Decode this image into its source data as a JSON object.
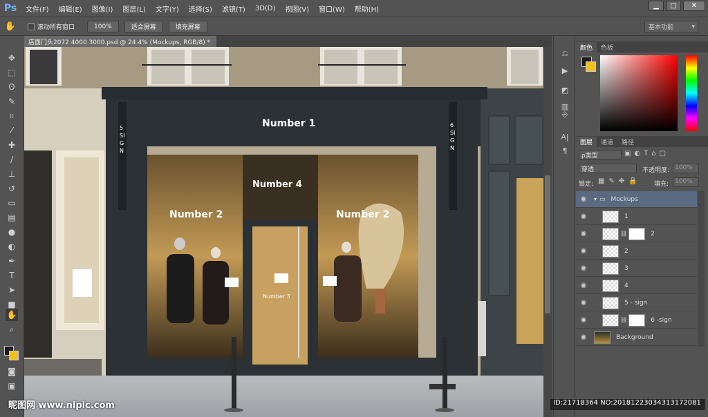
{
  "app_logo": "Ps",
  "menu": [
    "文件(F)",
    "编辑(E)",
    "图像(I)",
    "图层(L)",
    "文字(Y)",
    "选择(S)",
    "滤镜(T)",
    "3D(D)",
    "视图(V)",
    "窗口(W)",
    "帮助(H)"
  ],
  "window_controls": {
    "minimize": "▁",
    "restore": "□",
    "close": "✕"
  },
  "options": {
    "scroll_all": "滚动所有窗口",
    "zoom_100": "100%",
    "fit_screen": "适合屏幕",
    "fill_screen": "填充屏幕",
    "workspace": "基本功能"
  },
  "document_tab": "店面门头2072 4000 3000.psd @ 24.4% (Mockups, RGB/8) *",
  "document_tab_close": "×",
  "color_panel": {
    "tabs": [
      "颜色",
      "色板"
    ],
    "foreground": "#1a1a1a",
    "background": "#f0c020"
  },
  "layers_panel": {
    "tabs": [
      "图层",
      "通道",
      "路径"
    ],
    "filter_kind": "ρ类型",
    "blend_mode": "穿透",
    "opacity_label": "不透明度:",
    "opacity_value": "100%",
    "lock_label": "锁定:",
    "fill_label": "填充:",
    "fill_value": "100%",
    "group_name": "Mockups",
    "layers": [
      {
        "name": "1",
        "mask": false
      },
      {
        "name": "2",
        "mask": true
      },
      {
        "name": "2",
        "mask": false
      },
      {
        "name": "3",
        "mask": false
      },
      {
        "name": "4",
        "mask": false
      },
      {
        "name": "5 - sign",
        "mask": false
      },
      {
        "name": "6 -sign",
        "mask": true
      }
    ],
    "background_layer": "Background"
  },
  "storefront": {
    "top_sign": "Number 1",
    "left_window": "Number 2",
    "right_window": "Number 2",
    "center_sign": "Number 4",
    "door_sign": "Number 3",
    "left_pillar": "5 SIGN",
    "right_pillar": "6 SIGN"
  },
  "watermark": {
    "left": "昵图网 www.nipic.com",
    "right": "ID:21718364 NO:20181223034313172081"
  },
  "colors": {
    "ui_bg": "#535353",
    "accent": "#6fb1ff",
    "selected_layer": "#5a6a80",
    "storefront": "#2b3135"
  }
}
